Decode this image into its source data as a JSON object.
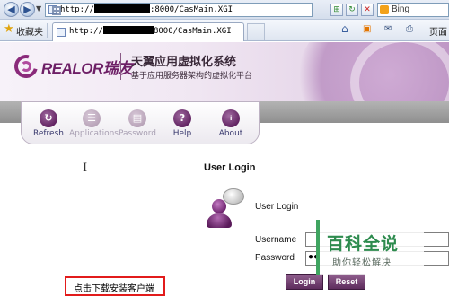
{
  "browser": {
    "address_prefix": "http://",
    "address_suffix": ":8000/CasMain.XGI",
    "search_text": "Bing",
    "favorites_label": "收藏夹",
    "tab_prefix": "http://",
    "tab_suffix": "8000/CasMain.XGI",
    "page_menu_label": "页面"
  },
  "header": {
    "logo_text": "REALOR瑞友",
    "title": "天翼应用虚拟化系统",
    "subtitle": "基于应用服务器架构的虚拟化平台"
  },
  "toolbar": {
    "items": [
      {
        "label": "Refresh",
        "icon": "refresh-icon",
        "enabled": true
      },
      {
        "label": "Applications",
        "icon": "applications-icon",
        "enabled": false
      },
      {
        "label": "Password",
        "icon": "password-icon",
        "enabled": false
      },
      {
        "label": "Help",
        "icon": "help-icon",
        "enabled": true
      },
      {
        "label": "About",
        "icon": "about-icon",
        "enabled": true
      }
    ]
  },
  "login": {
    "title": "User Login",
    "icon_caption": "User Login",
    "username_label": "Username",
    "password_label": "Password",
    "password_mask": "●●",
    "login_button": "Login",
    "reset_button": "Reset"
  },
  "download": {
    "link_text": "点击下载安装客户端"
  },
  "watermark": {
    "title": "百科全说",
    "subtitle": "助你轻松解决"
  },
  "colors": {
    "brand_purple": "#6d1f66",
    "button_purple": "#5e2d5d",
    "highlight_red": "#e21b1b",
    "watermark_green": "#2d8b4e"
  }
}
